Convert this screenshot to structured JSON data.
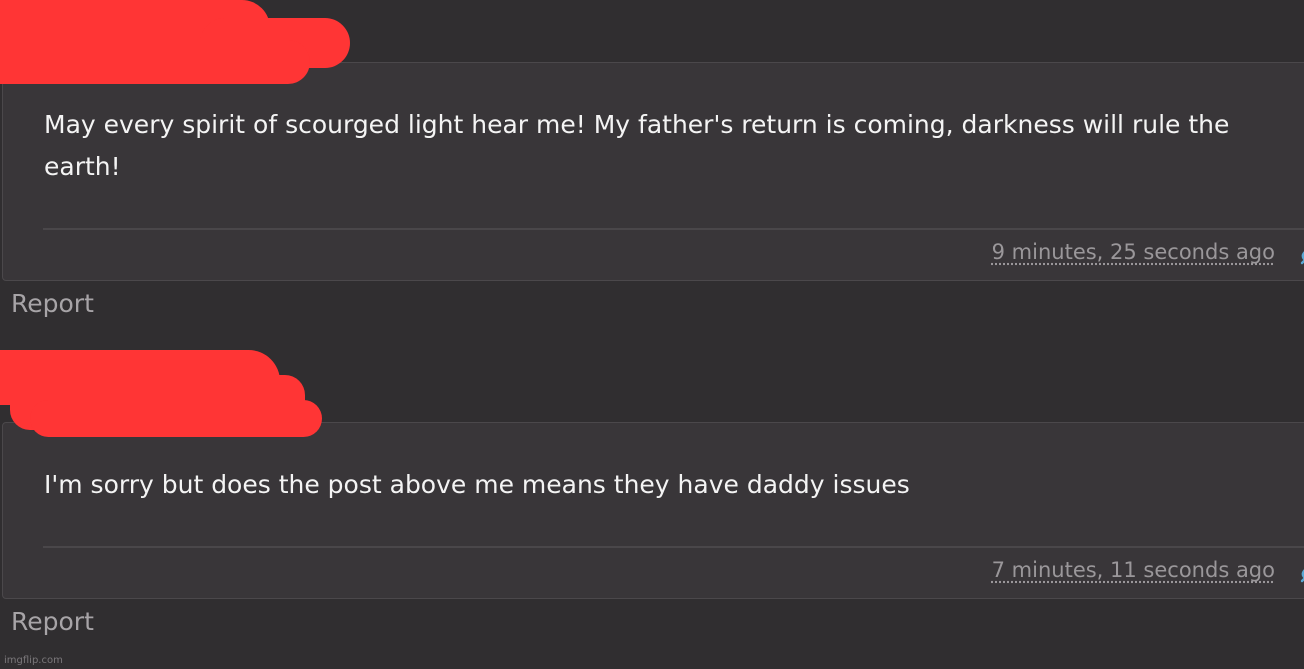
{
  "posts": [
    {
      "body": "May every spirit of scourged light hear me! My father's return is coming, darkness will rule the earth!",
      "timestamp": "9 minutes, 25 seconds ago",
      "report_label": "Report",
      "link_icon": "link-icon"
    },
    {
      "body": "I'm sorry but does the post above me means they have daddy issues",
      "timestamp": "7 minutes, 11 seconds ago",
      "report_label": "Report",
      "link_icon": "link-icon"
    }
  ],
  "watermark": "imgflip.com",
  "colors": {
    "background": "#302e30",
    "card": "#393639",
    "redaction": "#ff3535",
    "link_icon": "#5aa9d6",
    "muted_text": "#9a979a"
  }
}
